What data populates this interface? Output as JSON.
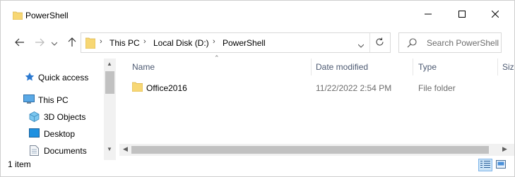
{
  "window": {
    "title": "PowerShell",
    "icon": "folder-icon",
    "controls": [
      "minimize-icon",
      "maximize-icon",
      "close-icon"
    ]
  },
  "address": {
    "crumbs": [
      "This PC",
      "Local Disk (D:)",
      "PowerShell"
    ],
    "chevron_glyph": "›"
  },
  "search": {
    "placeholder": "Search PowerShell"
  },
  "sidebar": {
    "items": [
      {
        "label": "Quick access",
        "icon": "star-icon"
      },
      {
        "label": "This PC",
        "icon": "computer-icon"
      },
      {
        "label": "3D Objects",
        "icon": "cube-icon"
      },
      {
        "label": "Desktop",
        "icon": "desktop-icon"
      },
      {
        "label": "Documents",
        "icon": "documents-icon"
      }
    ]
  },
  "columns": {
    "name": "Name",
    "date": "Date modified",
    "type": "Type",
    "size": "Siz"
  },
  "files": [
    {
      "name": "Office2016",
      "date": "11/22/2022 2:54 PM",
      "type": "File folder",
      "icon": "folder-icon"
    }
  ],
  "status": {
    "count": "1 item"
  },
  "colors": {
    "folder": "#f7d774",
    "header_text": "#4d5a72",
    "accent": "#0a64ad"
  }
}
